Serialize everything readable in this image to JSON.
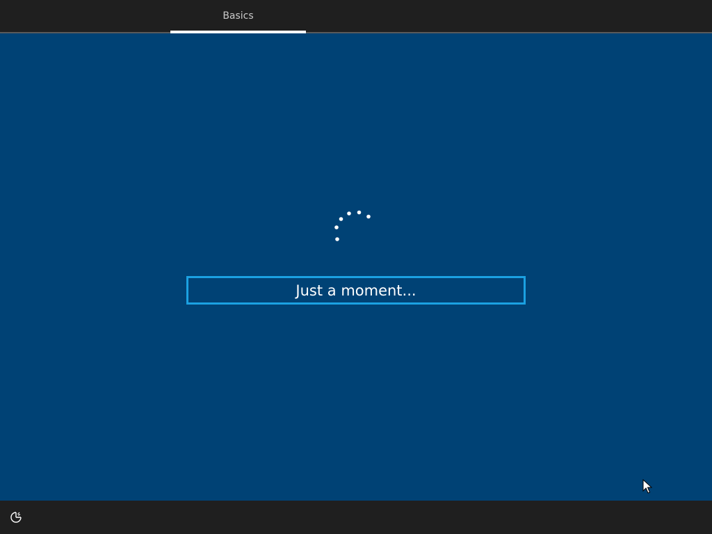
{
  "header": {
    "tabs": [
      {
        "label": "Basics",
        "active": true
      }
    ]
  },
  "main": {
    "status_text": "Just a moment...",
    "spinner_icon": "loading-dots-icon"
  },
  "footer": {
    "accessibility_icon": "ease-of-access-icon"
  },
  "colors": {
    "background": "#004275",
    "bars": "#1f1f1f",
    "accent": "#1ba1e2",
    "text": "#ffffff",
    "tab_text": "#c9c9c9"
  }
}
